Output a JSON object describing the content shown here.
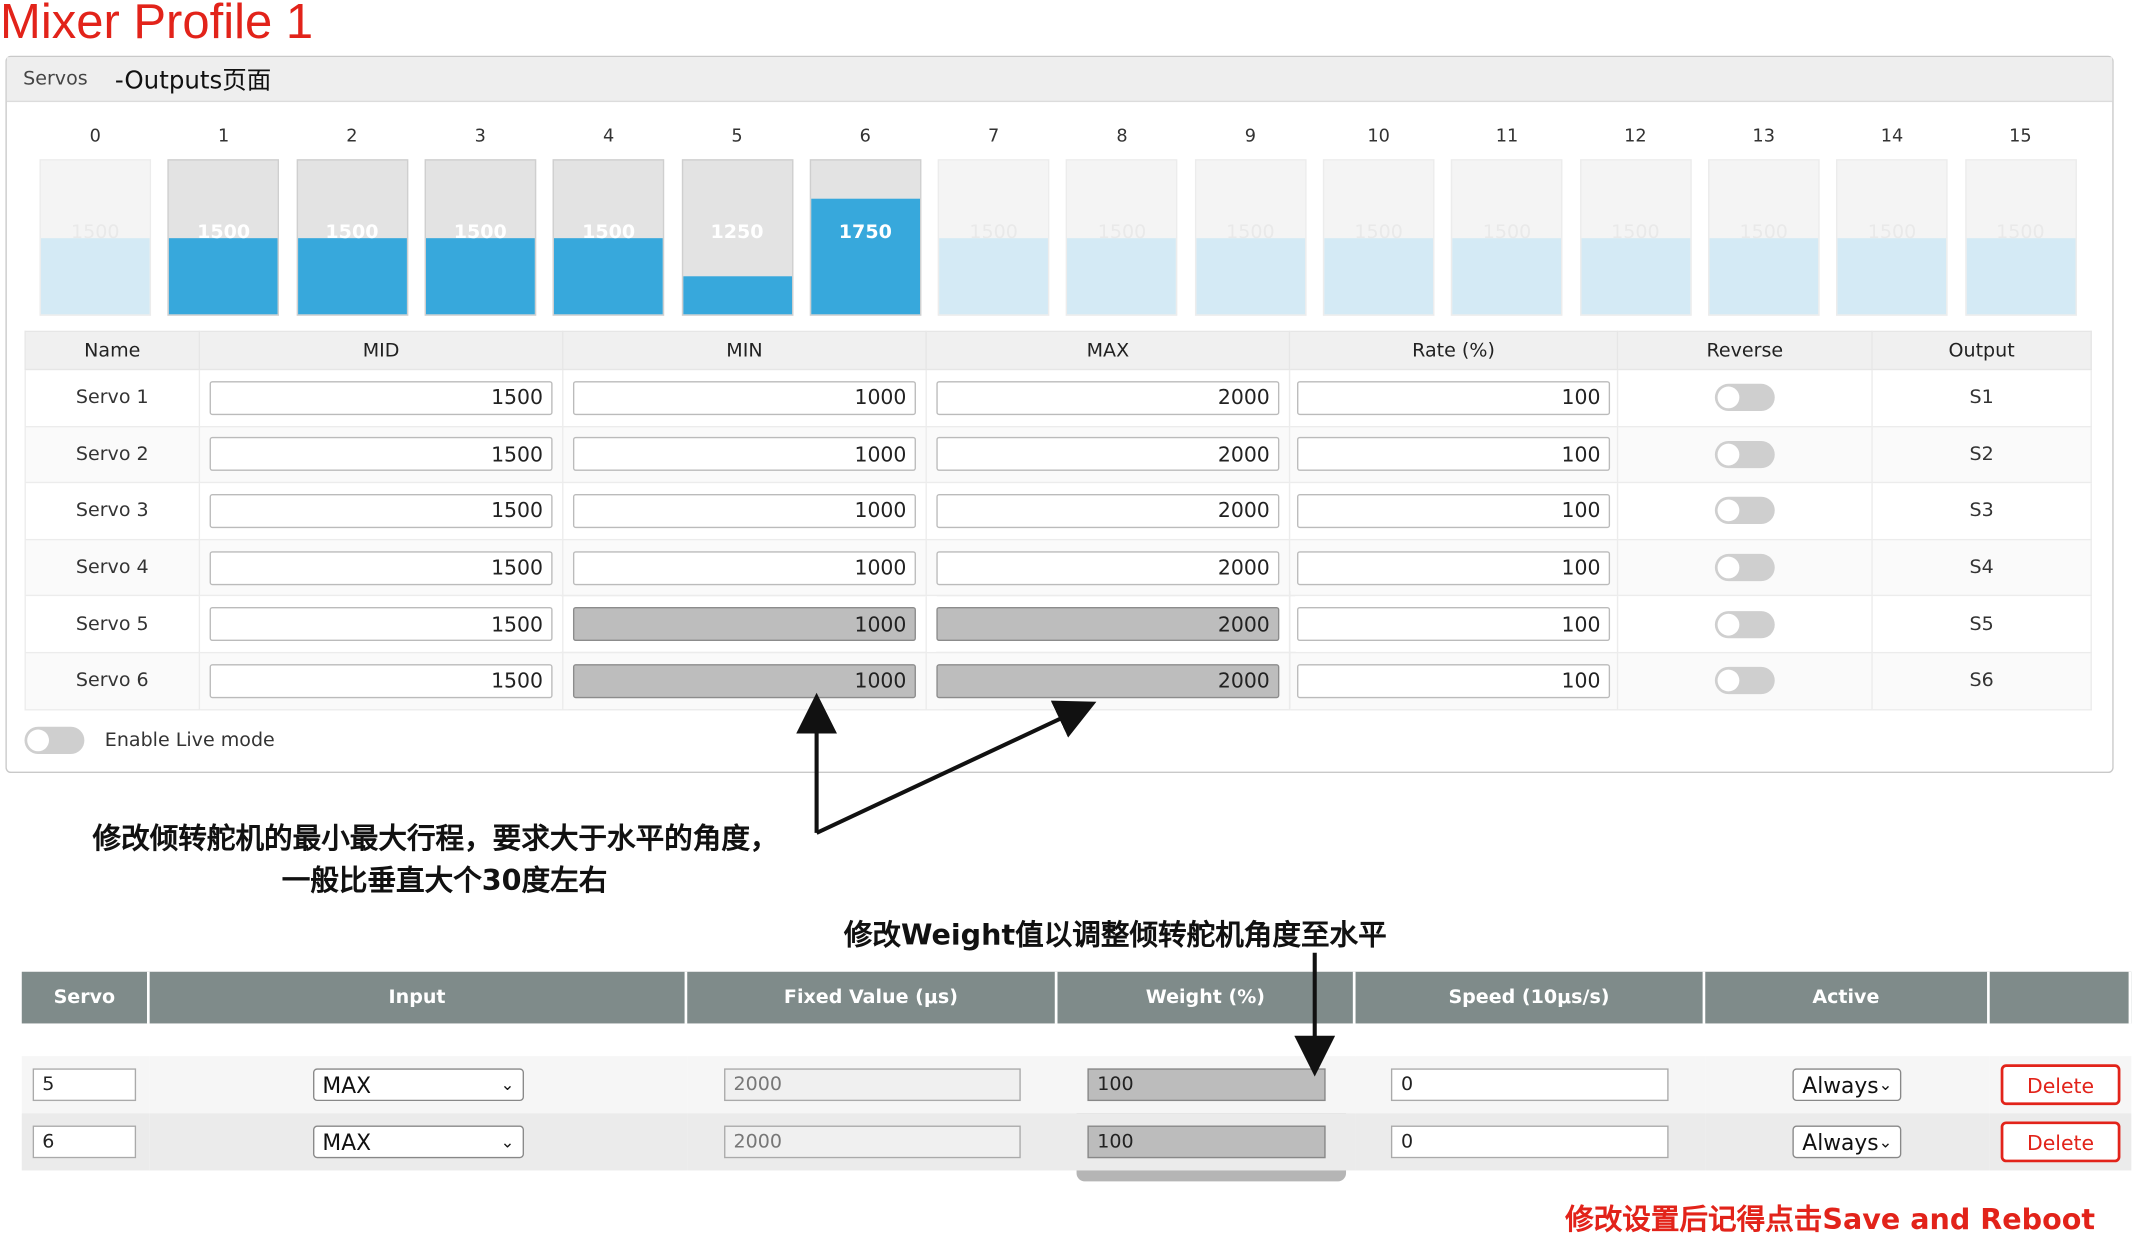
{
  "page_title": "Mixer Profile 1",
  "servos_panel": {
    "label": "Servos",
    "subtitle": "-Outputs页面",
    "bars": [
      {
        "index": "0",
        "value": "1500",
        "state": "dim",
        "level": 0.5
      },
      {
        "index": "1",
        "value": "1500",
        "state": "active",
        "level": 0.5
      },
      {
        "index": "2",
        "value": "1500",
        "state": "active",
        "level": 0.5
      },
      {
        "index": "3",
        "value": "1500",
        "state": "active",
        "level": 0.5
      },
      {
        "index": "4",
        "value": "1500",
        "state": "active",
        "level": 0.5
      },
      {
        "index": "5",
        "value": "1250",
        "state": "active",
        "level": 0.25
      },
      {
        "index": "6",
        "value": "1750",
        "state": "active",
        "level": 0.75
      },
      {
        "index": "7",
        "value": "1500",
        "state": "dim",
        "level": 0.5
      },
      {
        "index": "8",
        "value": "1500",
        "state": "dim",
        "level": 0.5
      },
      {
        "index": "9",
        "value": "1500",
        "state": "dim",
        "level": 0.5
      },
      {
        "index": "10",
        "value": "1500",
        "state": "dim",
        "level": 0.5
      },
      {
        "index": "11",
        "value": "1500",
        "state": "dim",
        "level": 0.5
      },
      {
        "index": "12",
        "value": "1500",
        "state": "dim",
        "level": 0.5
      },
      {
        "index": "13",
        "value": "1500",
        "state": "dim",
        "level": 0.5
      },
      {
        "index": "14",
        "value": "1500",
        "state": "dim",
        "level": 0.5
      },
      {
        "index": "15",
        "value": "1500",
        "state": "dim",
        "level": 0.5
      }
    ],
    "table": {
      "headers": {
        "name": "Name",
        "mid": "MID",
        "min": "MIN",
        "max": "MAX",
        "rate": "Rate (%)",
        "reverse": "Reverse",
        "output": "Output"
      },
      "rows": [
        {
          "name": "Servo 1",
          "mid": "1500",
          "min": "1000",
          "max": "2000",
          "rate": "100",
          "output": "S1"
        },
        {
          "name": "Servo 2",
          "mid": "1500",
          "min": "1000",
          "max": "2000",
          "rate": "100",
          "output": "S2"
        },
        {
          "name": "Servo 3",
          "mid": "1500",
          "min": "1000",
          "max": "2000",
          "rate": "100",
          "output": "S3"
        },
        {
          "name": "Servo 4",
          "mid": "1500",
          "min": "1000",
          "max": "2000",
          "rate": "100",
          "output": "S4"
        },
        {
          "name": "Servo 5",
          "mid": "1500",
          "min": "1000",
          "max": "2000",
          "rate": "100",
          "output": "S5"
        },
        {
          "name": "Servo 6",
          "mid": "1500",
          "min": "1000",
          "max": "2000",
          "rate": "100",
          "output": "S6"
        }
      ]
    },
    "live_mode_label": "Enable Live mode"
  },
  "annotations": {
    "minmax_line1": "修改倾转舵机的最小最大行程，要求大于水平的角度，",
    "minmax_line2": "一般比垂直大个30度左右",
    "weight_note": "修改Weight值以调整倾转舵机角度至水平",
    "save_note": "修改设置后记得点击Save and Reboot"
  },
  "mixer_table": {
    "headers": {
      "servo": "Servo",
      "input": "Input",
      "fixed": "Fixed Value (μs)",
      "weight": "Weight (%)",
      "speed": "Speed (10μs/s)",
      "active": "Active"
    },
    "rows": [
      {
        "servo": "5",
        "input": "MAX",
        "fixed": "2000",
        "weight": "100",
        "speed": "0",
        "active": "Always",
        "delete": "Delete"
      },
      {
        "servo": "6",
        "input": "MAX",
        "fixed": "2000",
        "weight": "100",
        "speed": "0",
        "active": "Always",
        "delete": "Delete"
      }
    ]
  },
  "colors": {
    "accent": "#37a8dc",
    "title_red": "#e2231a",
    "header_gray": "#7f8b8a"
  }
}
